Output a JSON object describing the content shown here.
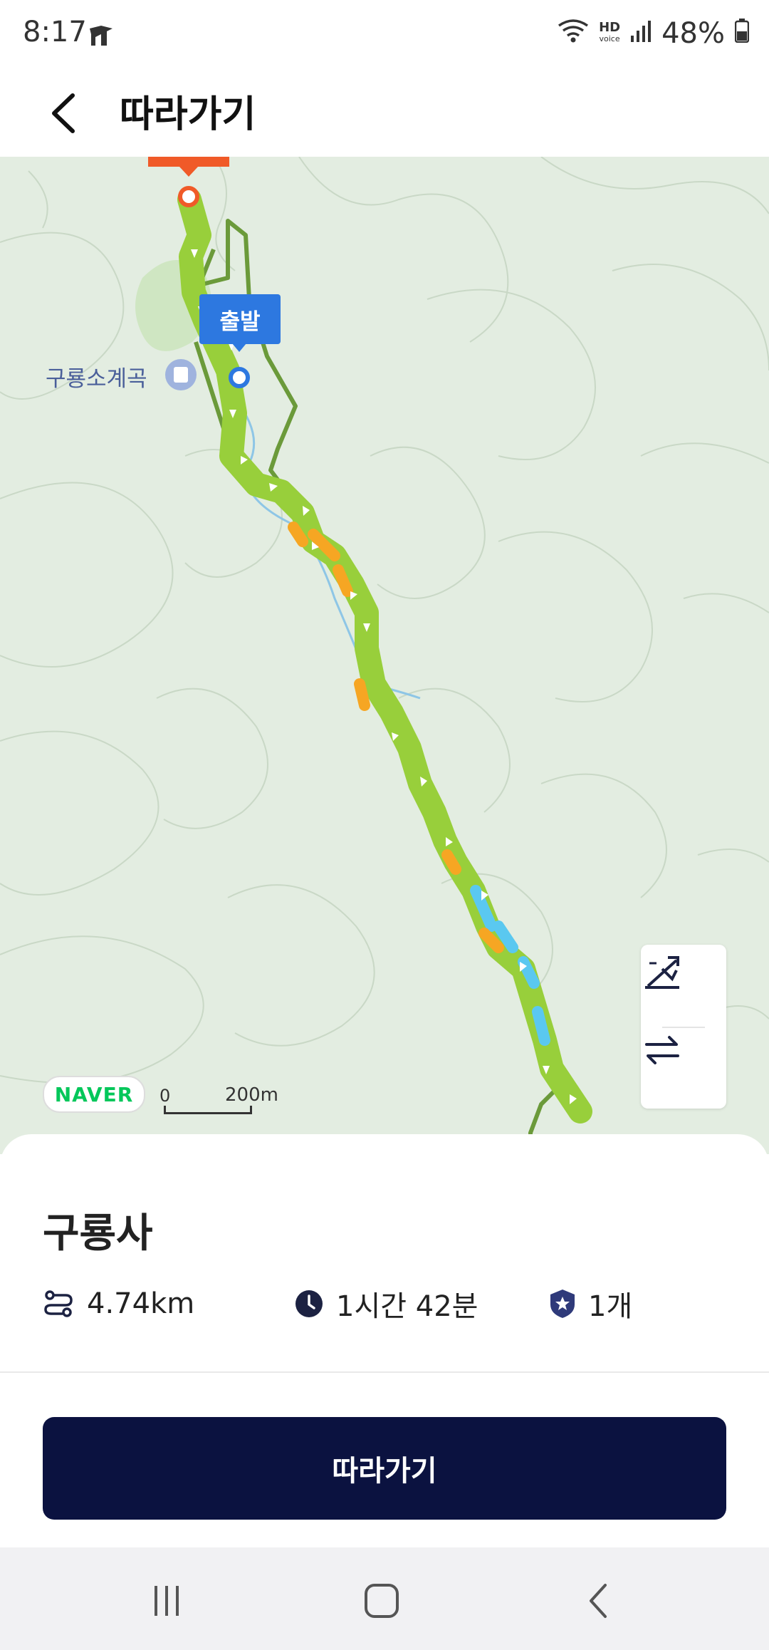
{
  "status_bar": {
    "time": "8:17",
    "hd_voice_top": "HD",
    "hd_voice_bottom": "voice",
    "battery": "48%"
  },
  "header": {
    "back_icon": "chevron-left-icon",
    "title": "따라가기"
  },
  "map": {
    "start_marker_label": "출발",
    "poi_label": "구룡소계곡",
    "provider_logo": "NAVER",
    "scale_zero": "0",
    "scale_distance": "200m",
    "controls": [
      "elevation-icon",
      "swap-direction-icon"
    ],
    "colors": {
      "route_main": "#98cf3b",
      "route_uphill": "#f6a623",
      "route_downhill": "#5ac8f0",
      "trail_line": "#6b9a3a",
      "start_marker": "#2d78e0",
      "end_marker": "#f05a28"
    }
  },
  "sheet": {
    "place_name": "구룡사",
    "distance": "4.74km",
    "duration": "1시간 42분",
    "badge_count": "1개",
    "stat_icons": [
      "route-distance-icon",
      "clock-icon",
      "shield-star-icon"
    ],
    "follow_button_label": "따라가기"
  },
  "nav_bar": {
    "buttons": [
      "recent-apps-icon",
      "home-icon",
      "back-icon"
    ]
  }
}
